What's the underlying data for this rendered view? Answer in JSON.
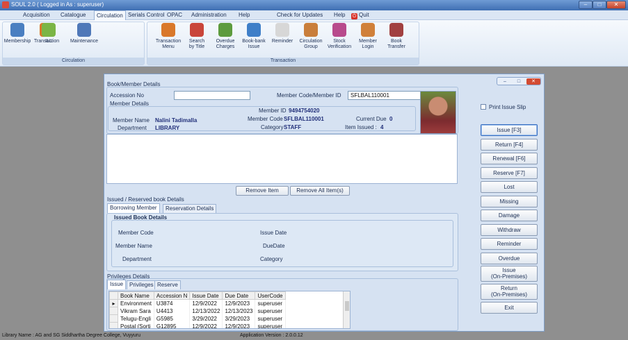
{
  "window": {
    "title": "SOUL 2.0 ( Logged in As : superuser)"
  },
  "menu": {
    "items": [
      "Acquisition",
      "Catalogue",
      "Circulation",
      "Serials Control",
      "OPAC",
      "Administration",
      "Help"
    ],
    "check_updates": "Check for Updates",
    "help": "Help",
    "quit": "Quit",
    "active": "Circulation"
  },
  "ribbon": {
    "circulation_group": "Circulation",
    "transaction_group": "Transaction",
    "buttons_circulation": [
      {
        "label": "Membership",
        "sub": "",
        "color": "#4a7fc1"
      },
      {
        "label": "Transaction",
        "sub": "",
        "color": "#d9782a"
      },
      {
        "label": "ILL",
        "sub": "",
        "color": "#7bb545"
      },
      {
        "label": "Maintenance",
        "sub": "",
        "color": "#4f78b8"
      }
    ],
    "buttons_transaction": [
      {
        "label": "Transaction",
        "sub": "Menu",
        "color": "#d9782a"
      },
      {
        "label": "Search",
        "sub": "by Title",
        "color": "#c9453a"
      },
      {
        "label": "Overdue",
        "sub": "Charges",
        "color": "#5d9b3e"
      },
      {
        "label": "Book-bank",
        "sub": "Issue",
        "color": "#3f7fc8"
      },
      {
        "label": "Reminder",
        "sub": "",
        "color": "#d7d7d7"
      },
      {
        "label": "Circulation",
        "sub": "Group",
        "color": "#c97e3b"
      },
      {
        "label": "Stock",
        "sub": "Verification",
        "color": "#b84a8c"
      },
      {
        "label": "Member",
        "sub": "Login",
        "color": "#d0803a"
      },
      {
        "label": "Book",
        "sub": "Transfer",
        "color": "#a14040"
      }
    ]
  },
  "form": {
    "book_member_group": "Book/Member Details",
    "accession_label": "Accession No",
    "accession_value": "",
    "member_code_id_label": "Member Code/Member ID",
    "member_code_id_value": "SFLBAL110001",
    "member_details_label": "Member Details",
    "member_name_label": "Member Name",
    "member_name_value": "Nalini Tadimalla",
    "department_label": "Department",
    "department_value": "LIBRARY",
    "member_id_label": "Member ID",
    "member_id_value": "9494754020",
    "member_code_label": "Member Code",
    "member_code_value": "SFLBAL110001",
    "category_label": "Category",
    "category_value": "STAFF",
    "current_due_label": "Current Due",
    "current_due_value": "0",
    "item_issued_label": "Item Issued :",
    "item_issued_value": "4",
    "remove_item": "Remove Item",
    "remove_all": "Remove All Item(s)"
  },
  "issued": {
    "group_label": "Issued / Reserved book Details",
    "tabs": [
      "Borrowing Member",
      "Reservation Details"
    ],
    "issued_book_details": "Issued Book Details",
    "member_code": "Member Code",
    "issue_date": "Issue Date",
    "member_name": "Member Name",
    "due_date": "DueDate",
    "department": "Department",
    "category": "Category"
  },
  "privileges": {
    "group_label": "Privileges Details",
    "tabs": [
      "Issue",
      "Privileges",
      "Reserve"
    ],
    "columns": [
      "Book Name",
      "Accession N",
      "Issue Date",
      "Due Date",
      "UserCode"
    ],
    "rows": [
      [
        "Environment",
        "U3874",
        "12/9/2022",
        "12/9/2023",
        "superuser"
      ],
      [
        "Vikram Sara",
        "U4413",
        "12/13/2022",
        "12/13/2023",
        "superuser"
      ],
      [
        "Telugu-Engli",
        "G5985",
        "3/29/2022",
        "3/29/2023",
        "superuser"
      ],
      [
        "Postal (Sorti",
        "G12895",
        "12/9/2022",
        "12/9/2023",
        "superuser"
      ]
    ]
  },
  "side": {
    "print_slip": "Print Issue Slip",
    "buttons": [
      "Issue [F3]",
      "Return [F4]",
      "Renewal [F6]",
      "Reserve [F7]",
      "Lost",
      "Missing",
      "Damage",
      "Withdraw",
      "Reminder",
      "Overdue"
    ],
    "issue_premises": [
      "Issue",
      "(On-Premises)"
    ],
    "return_premises": [
      "Return",
      "(On-Premises)"
    ],
    "exit": "Exit"
  },
  "status": {
    "library_name": "Library Name : AG and SG Siddhartha Degree College, Vuyyuru",
    "version": "Application Version : 2.0.0.12"
  }
}
